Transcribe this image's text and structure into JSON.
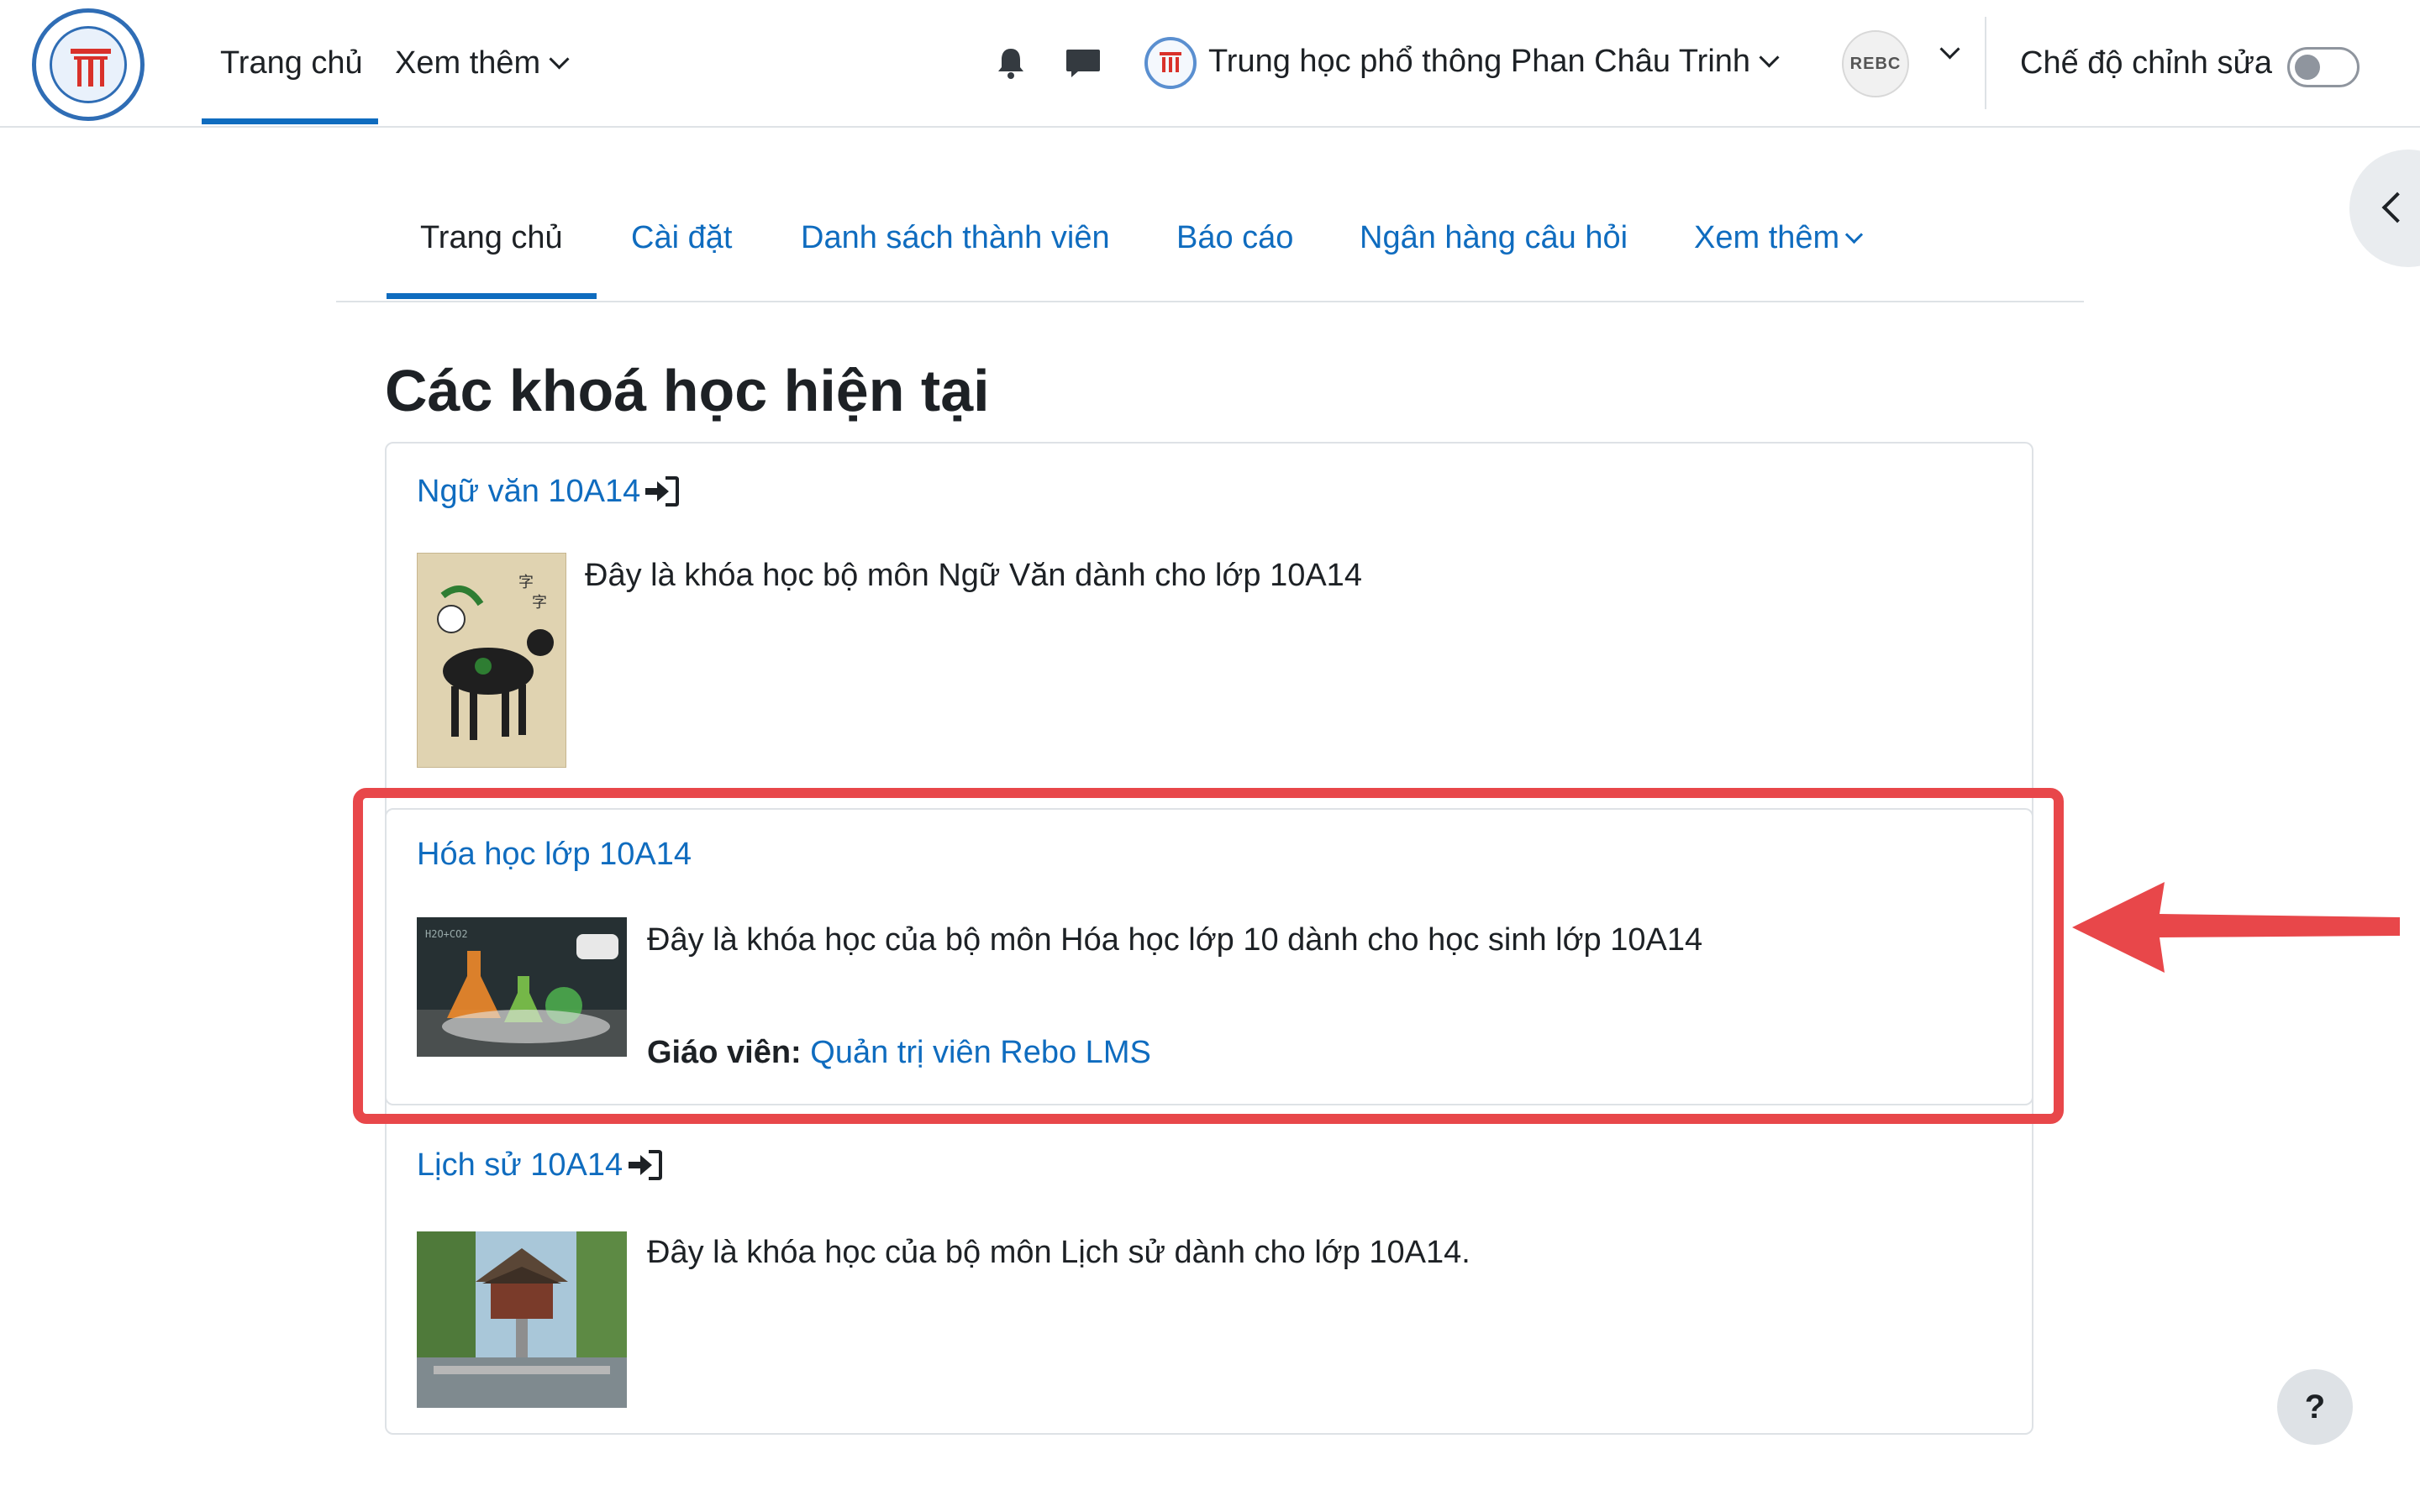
{
  "navbar": {
    "home_label": "Trang chủ",
    "more_label": "Xem thêm",
    "school_name": "Trung học phổ thông Phan Châu Trinh",
    "avatar_text": "REBC",
    "edit_mode_label": "Chế độ chỉnh sửa",
    "edit_mode_on": false
  },
  "subnav": {
    "items": [
      "Trang chủ",
      "Cài đặt",
      "Danh sách thành viên",
      "Báo cáo",
      "Ngân hàng câu hỏi",
      "Xem thêm"
    ]
  },
  "page": {
    "title": "Các khoá học hiện tại"
  },
  "courses": [
    {
      "name": "Ngữ văn 10A14",
      "summary": "Đây là khóa học bộ môn Ngữ Văn dành cho lớp 10A14",
      "image_icon": "buffalo-painting"
    },
    {
      "name": "Hóa học lớp 10A14",
      "summary": "Đây là khóa học của bộ môn Hóa học lớp 10 dành cho học sinh lớp 10A14",
      "teacher_label": "Giáo viên:",
      "teacher_name": "Quản trị viên Rebo LMS",
      "image_icon": "chemistry-flasks"
    },
    {
      "name": "Lịch sử 10A14",
      "summary": "Đây là khóa học của bộ môn Lịch sử dành cho lớp 10A14.",
      "image_icon": "one-pillar-pagoda"
    }
  ],
  "help": {
    "label": "?"
  },
  "colors": {
    "link": "#0f6cbf",
    "highlight": "#e8474a"
  }
}
